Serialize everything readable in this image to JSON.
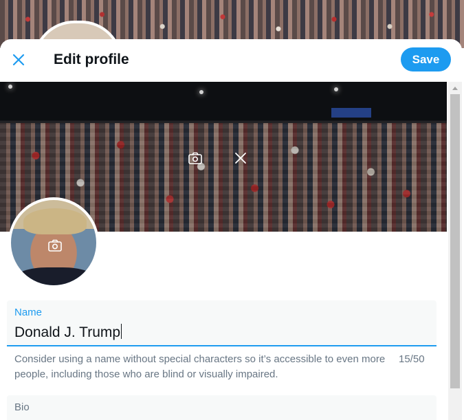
{
  "header": {
    "title": "Edit profile",
    "save_label": "Save"
  },
  "icons": {
    "close": "close-icon",
    "banner_camera": "camera-icon",
    "banner_remove": "remove-icon",
    "avatar_camera": "camera-icon",
    "scroll_up": "chevron-up-icon"
  },
  "form": {
    "name": {
      "label": "Name",
      "value": "Donald J. Trump",
      "counter": "15/50",
      "hint": "Consider using a name without special characters so it’s accessible to even more people, including those who are blind or visually impaired."
    },
    "bio": {
      "label": "Bio"
    }
  },
  "colors": {
    "accent": "#1d9bf0",
    "text": "#0f1419",
    "muted": "#687684"
  }
}
